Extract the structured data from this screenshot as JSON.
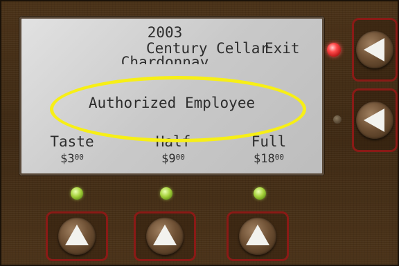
{
  "display": {
    "year": "2003",
    "wine_name": "Century Cellar",
    "exit_label": "Exit",
    "varietal": "Chardonnay",
    "highlight_message": "Authorized Employee",
    "options": [
      {
        "label": "Taste",
        "price_dollars": "$3",
        "price_cents": "00"
      },
      {
        "label": "Half",
        "price_dollars": "$9",
        "price_cents": "00"
      },
      {
        "label": "Full",
        "price_dollars": "$18",
        "price_cents": "00"
      }
    ]
  },
  "indicators": {
    "exit_led": "red-lit",
    "second_side_led": "off",
    "option_leds": [
      "green-lit",
      "green-lit",
      "green-lit"
    ]
  },
  "controls": {
    "side_buttons": [
      {
        "icon": "triangle-left-icon",
        "action": "Exit"
      },
      {
        "icon": "triangle-left-icon",
        "action": ""
      }
    ],
    "bottom_buttons": [
      {
        "icon": "triangle-up-icon",
        "option": "Taste"
      },
      {
        "icon": "triangle-up-icon",
        "option": "Half"
      },
      {
        "icon": "triangle-up-icon",
        "option": "Full"
      }
    ]
  },
  "colors": {
    "panel_wood": "#3f2a14",
    "lcd_background": "#c9c9c9",
    "lcd_text": "#2d2d2d",
    "highlight_ellipse": "#f7ef16",
    "button_border": "#8a1a16",
    "led_red": "#ff4a4a",
    "led_green": "#a6d23c"
  }
}
